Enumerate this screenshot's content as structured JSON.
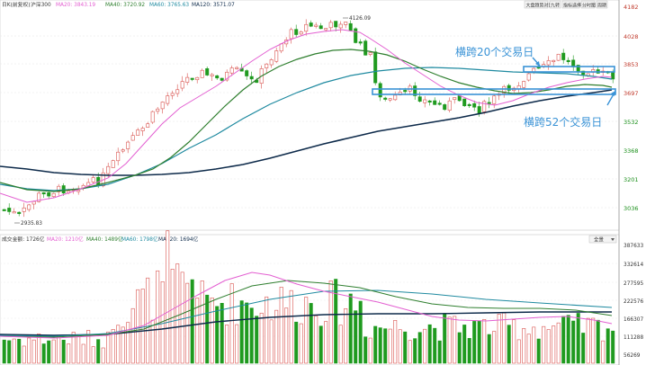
{
  "header": {
    "code": "日K(前复权)",
    "index": "沪深300",
    "ma_items": [
      {
        "label": "MA20: 3843.19",
        "color": "#e35fd1"
      },
      {
        "label": "MA40: 3720.92",
        "color": "#2f7f2f"
      },
      {
        "label": "MA60: 3765.63",
        "color": "#1f8aa0"
      },
      {
        "label": "MA120: 3571.07",
        "color": "#0d2a4a"
      }
    ]
  },
  "toolbar": {
    "buttons": [
      "大盘趋势对比",
      "九转",
      "指标选择",
      "分时图",
      "周期"
    ]
  },
  "price_axis": [
    "4182",
    "4028",
    "3853",
    "3697",
    "3532",
    "3368",
    "3201",
    "3036"
  ],
  "price_marks": {
    "high_label": "4126.09",
    "low_label": "2935.83"
  },
  "annotations": {
    "upper_text": "横跨20个交易日",
    "lower_text": "横跨52个交易日"
  },
  "volume_header": {
    "title": "成交金额: 1726亿",
    "ma_items": [
      {
        "label": "MA20: 1210亿",
        "color": "#e35fd1"
      },
      {
        "label": "MA40: 1489亿",
        "color": "#2f7f2f"
      },
      {
        "label": "MA60: 1798亿",
        "color": "#1f8aa0"
      },
      {
        "label": "MA120: 1694亿",
        "color": "#0d2a4a"
      }
    ],
    "dropdown": "全景"
  },
  "volume_axis": [
    "387633",
    "332614",
    "277595",
    "222576",
    "166307",
    "111288",
    "56269"
  ],
  "colors": {
    "up": "#d9534f",
    "down": "#1f9a1f",
    "annotation": "#3a93d6",
    "ma20": "#e35fd1",
    "ma40": "#2f7f2f",
    "ma60": "#1f8aa0",
    "ma120": "#0d2a4a"
  }
}
